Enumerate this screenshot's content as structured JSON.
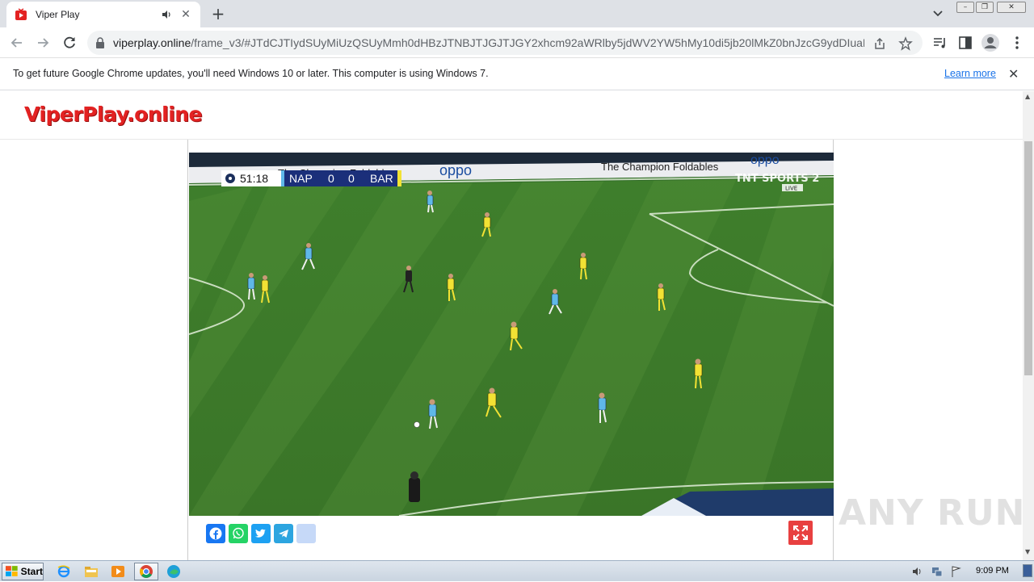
{
  "browser": {
    "tab": {
      "title": "Viper Play"
    },
    "new_tab_symbol": "+",
    "url": {
      "host": "viperplay.online",
      "path": "/frame_v3/#JTdCJTIydSUyMiUzQSUyMmh0dHBzJTNBJTJGJTJGY2xhcm92aWRlby5jdWV2YW5hMy10di5jb20lMkZ0bnJzcG9ydDIuaHR..."
    },
    "infobar": {
      "message": "To get future Google Chrome updates, you'll need Windows 10 or later. This computer is using Windows 7.",
      "link": "Learn more"
    }
  },
  "site": {
    "logo": "ViperPlay.online"
  },
  "scoreboard": {
    "clock": "51:18",
    "home_team": "NAP",
    "home_score": "0",
    "away_score": "0",
    "away_team": "BAR",
    "broadcaster": "TNT SPORTS 2",
    "live": "LIVE"
  },
  "ads": {
    "board1": "The Champion Foldables",
    "board2": "oppo",
    "board3": "The Champion Foldables",
    "board4": "oppo"
  },
  "share": [
    "facebook",
    "whatsapp",
    "twitter",
    "telegram",
    "more"
  ],
  "taskbar": {
    "start": "Start",
    "clock": "9:09 PM"
  },
  "watermark": "ANY RUN",
  "colors": {
    "logo": "#e32222",
    "napoli_kit": "#5fb8e8",
    "barca_kit": "#f2e234",
    "pitch": "#3d7a2a"
  }
}
